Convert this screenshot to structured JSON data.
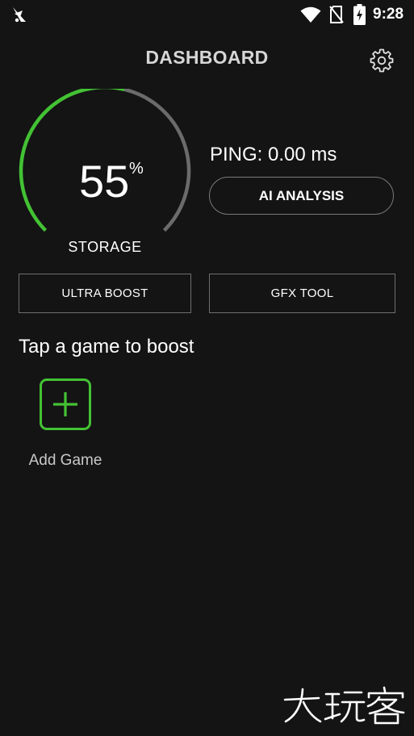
{
  "status_bar": {
    "time": "9:28",
    "icons": [
      "app-notification-icon",
      "wifi-icon",
      "no-sim-icon",
      "battery-charging-icon"
    ]
  },
  "header": {
    "title": "DASHBOARD",
    "settings_icon": "gear-icon"
  },
  "gauge": {
    "value": "55",
    "unit": "%",
    "label": "STORAGE",
    "fraction": 0.55,
    "active_color": "#43c234",
    "track_color": "#6b6b6b"
  },
  "ping": {
    "text": "PING: 0.00 ms"
  },
  "buttons": {
    "ai_analysis": "AI ANALYSIS",
    "ultra_boost": "ULTRA BOOST",
    "gfx_tool": "GFX TOOL"
  },
  "games": {
    "section_title": "Tap a game to boost",
    "add_label": "Add Game",
    "add_icon": "plus-icon"
  },
  "colors": {
    "background": "#141414",
    "accent": "#43c234"
  },
  "watermark": {
    "text": "大玩客"
  }
}
